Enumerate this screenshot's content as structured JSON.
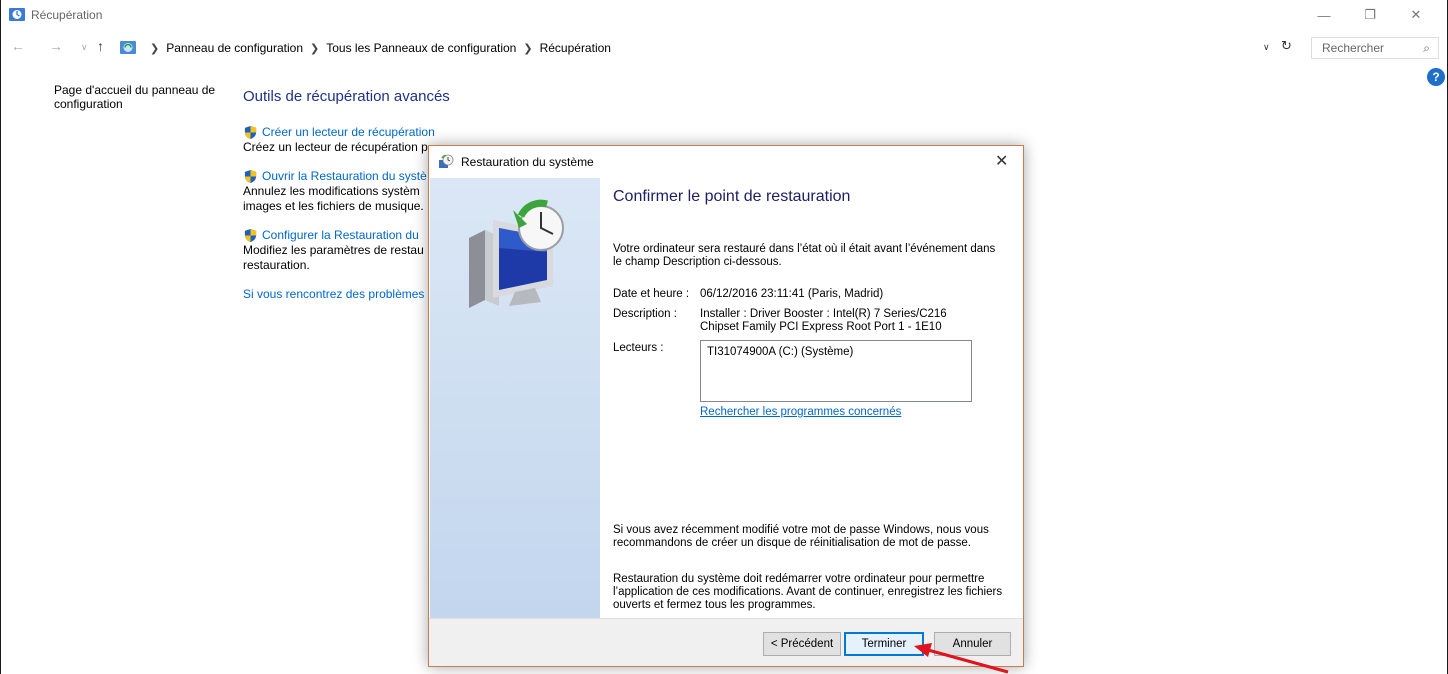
{
  "window": {
    "title": "Récupération"
  },
  "address": {
    "breadcrumbs": [
      "Panneau de configuration",
      "Tous les Panneaux de configuration",
      "Récupération"
    ],
    "search_placeholder": "Rechercher"
  },
  "sidebar": {
    "home_link": "Page d'accueil du panneau de configuration"
  },
  "main": {
    "heading": "Outils de récupération avancés",
    "tools": [
      {
        "link": "Créer un lecteur de récupération",
        "description": "Créez un lecteur de récupération p"
      },
      {
        "link": "Ouvrir la Restauration du systè",
        "description_line1": "Annulez les modifications systèm",
        "description_line2": "images et les fichiers de musique."
      },
      {
        "link": "Configurer la Restauration du",
        "description_line1": "Modifiez les paramètres de restau",
        "description_line2": "restauration."
      }
    ],
    "problems_link": "Si vous rencontrez des problèmes"
  },
  "dialog": {
    "title": "Restauration du système",
    "heading": "Confirmer le point de restauration",
    "intro": "Votre ordinateur sera restauré dans l’état où il était avant l’événement dans le champ Description ci-dessous.",
    "date_label": "Date et heure :",
    "date_value": "06/12/2016 23:11:41 (Paris, Madrid)",
    "description_label": "Description :",
    "description_value_line1": "Installer : Driver Booster : Intel(R) 7 Series/C216",
    "description_value_line2": "Chipset Family PCI Express Root Port 1 - 1E10",
    "drives_label": "Lecteurs :",
    "drives": [
      "TI31074900A (C:) (Système)"
    ],
    "affected_link": "Rechercher les programmes concernés",
    "note_password": "Si vous avez récemment modifié votre mot de passe Windows, nous vous recommandons de créer un disque de réinitialisation de mot de passe.",
    "note_restart": "Restauration du système doit redémarrer votre ordinateur pour permettre l’application de ces modifications. Avant de continuer, enregistrez les fichiers ouverts et fermez tous les programmes.",
    "buttons": {
      "previous": "< Précédent",
      "finish": "Terminer",
      "cancel": "Annuler"
    }
  },
  "colors": {
    "link": "#0066cc",
    "heading": "#1e3287",
    "dialog_border": "#c87e4c",
    "annotation_arrow": "#e0141e",
    "focus": "#0078d7"
  }
}
